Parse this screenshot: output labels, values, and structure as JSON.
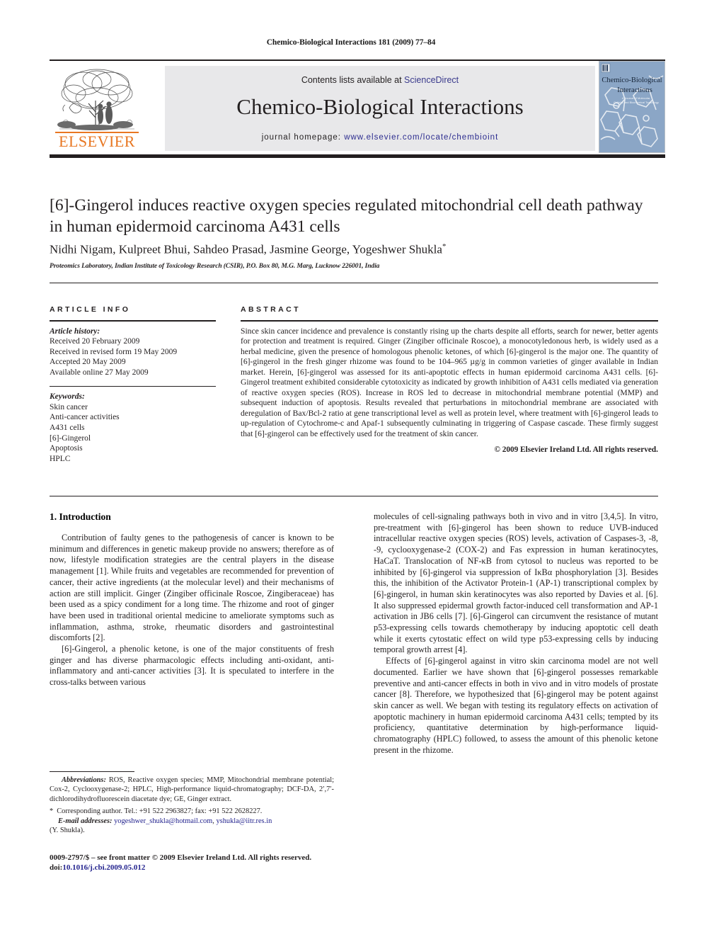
{
  "running_head": "Chemico-Biological Interactions 181 (2009) 77–84",
  "masthead": {
    "contents_prefix": "Contents lists available at ",
    "sciencedirect": "ScienceDirect",
    "journal_name": "Chemico-Biological Interactions",
    "homepage_label": "journal homepage:",
    "homepage_url": "www.elsevier.com/locate/chembioint",
    "publisher_wordmark": "ELSEVIER",
    "cover_title_line1": "Chemico-Biological",
    "cover_title_line2": "Interactions",
    "cover_subtitle_line1": "A Journal of Molecular,",
    "cover_subtitle_line2": "Cellular and Biochemical Toxicology",
    "link_color": "#2c2c8f",
    "panel_color": "#e8e8ea",
    "elsevier_orange": "#E87722"
  },
  "article": {
    "title": "[6]-Gingerol induces reactive oxygen species regulated mitochondrial cell death pathway in human epidermoid carcinoma A431 cells",
    "authors": "Nidhi Nigam, Kulpreet Bhui, Sahdeo Prasad, Jasmine George, Yogeshwer Shukla",
    "corresponding_marker": "*",
    "affiliation": "Proteomics Laboratory, Indian Institute of Toxicology Research (CSIR), P.O. Box 80, M.G. Marg, Lucknow 226001, India"
  },
  "article_info": {
    "heading": "ARTICLE INFO",
    "history_label": "Article history:",
    "history": [
      "Received 20 February 2009",
      "Received in revised form 19 May 2009",
      "Accepted 20 May 2009",
      "Available online 27 May 2009"
    ],
    "keywords_label": "Keywords:",
    "keywords": [
      "Skin cancer",
      "Anti-cancer activities",
      "A431 cells",
      "[6]-Gingerol",
      "Apoptosis",
      "HPLC"
    ]
  },
  "abstract": {
    "heading": "ABSTRACT",
    "text": "Since skin cancer incidence and prevalence is constantly rising up the charts despite all efforts, search for newer, better agents for protection and treatment is required. Ginger (Zingiber officinale Roscoe), a monocotyledonous herb, is widely used as a herbal medicine, given the presence of homologous phenolic ketones, of which [6]-gingerol is the major one. The quantity of [6]-gingerol in the fresh ginger rhizome was found to be 104–965 µg/g in common varieties of ginger available in Indian market. Herein, [6]-gingerol was assessed for its anti-apoptotic effects in human epidermoid carcinoma A431 cells. [6]-Gingerol treatment exhibited considerable cytotoxicity as indicated by growth inhibition of A431 cells mediated via generation of reactive oxygen species (ROS). Increase in ROS led to decrease in mitochondrial membrane potential (MMP) and subsequent induction of apoptosis. Results revealed that perturbations in mitochondrial membrane are associated with deregulation of Bax/Bcl-2 ratio at gene transcriptional level as well as protein level, where treatment with [6]-gingerol leads to up-regulation of Cytochrome-c and Apaf-1 subsequently culminating in triggering of Caspase cascade. These firmly suggest that [6]-gingerol can be effectively used for the treatment of skin cancer.",
    "copyright": "© 2009 Elsevier Ireland Ltd. All rights reserved."
  },
  "body": {
    "section_number_title": "1. Introduction",
    "left_paragraphs": [
      "Contribution of faulty genes to the pathogenesis of cancer is known to be minimum and differences in genetic makeup provide no answers; therefore as of now, lifestyle modification strategies are the central players in the disease management [1]. While fruits and vegetables are recommended for prevention of cancer, their active ingredients (at the molecular level) and their mechanisms of action are still implicit. Ginger (Zingiber officinale Roscoe, Zingiberaceae) has been used as a spicy condiment for a long time. The rhizome and root of ginger have been used in traditional oriental medicine to ameliorate symptoms such as inflammation, asthma, stroke, rheumatic disorders and gastrointestinal discomforts [2].",
      "[6]-Gingerol, a phenolic ketone, is one of the major constituents of fresh ginger and has diverse pharmacologic effects including anti-oxidant, anti-inflammatory and anti-cancer activities [3]. It is speculated to interfere in the cross-talks between various"
    ],
    "right_paragraphs": [
      "molecules of cell-signaling pathways both in vivo and in vitro [3,4,5]. In vitro, pre-treatment with [6]-gingerol has been shown to reduce UVB-induced intracellular reactive oxygen species (ROS) levels, activation of Caspases-3, -8, -9, cyclooxygenase-2 (COX-2) and Fas expression in human keratinocytes, HaCaT. Translocation of NF-κB from cytosol to nucleus was reported to be inhibited by [6]-gingerol via suppression of IκBα phosphorylation [3]. Besides this, the inhibition of the Activator Protein-1 (AP-1) transcriptional complex by [6]-gingerol, in human skin keratinocytes was also reported by Davies et al. [6]. It also suppressed epidermal growth factor-induced cell transformation and AP-1 activation in JB6 cells [7]. [6]-Gingerol can circumvent the resistance of mutant p53-expressing cells towards chemotherapy by inducing apoptotic cell death while it exerts cytostatic effect on wild type p53-expressing cells by inducing temporal growth arrest [4].",
      "Effects of [6]-gingerol against in vitro skin carcinoma model are not well documented. Earlier we have shown that [6]-gingerol possesses remarkable preventive and anti-cancer effects in both in vivo and in vitro models of prostate cancer [8]. Therefore, we hypothesized that [6]-gingerol may be potent against skin cancer as well. We began with testing its regulatory effects on activation of apoptotic machinery in human epidermoid carcinoma A431 cells; tempted by its proficiency, quantitative determination by high-performance liquid-chromatography (HPLC) followed, to assess the amount of this phenolic ketone present in the rhizome."
    ]
  },
  "footnotes": {
    "abbreviations_label": "Abbreviations:",
    "abbreviations_text": "ROS, Reactive oxygen species; MMP, Mitochondrial membrane potential; Cox-2, Cyclooxygenase-2; HPLC, High-performance liquid-chromatography; DCF-DA, 2′,7′-dichlorodihydrofluorescein diacetate dye; GE, Ginger extract.",
    "corresponding_marker": "*",
    "corresponding_text": "Corresponding author. Tel.: +91 522 2963827; fax: +91 522 2628227.",
    "email_label": "E-mail addresses:",
    "email_1": "yogeshwer_shukla@hotmail.com",
    "email_2": "yshukla@iitr.res.in",
    "email_owner": "(Y. Shukla)."
  },
  "footer": {
    "issn_line": "0009-2797/$ – see front matter © 2009 Elsevier Ireland Ltd. All rights reserved.",
    "doi_label": "doi:",
    "doi": "10.1016/j.cbi.2009.05.012"
  }
}
